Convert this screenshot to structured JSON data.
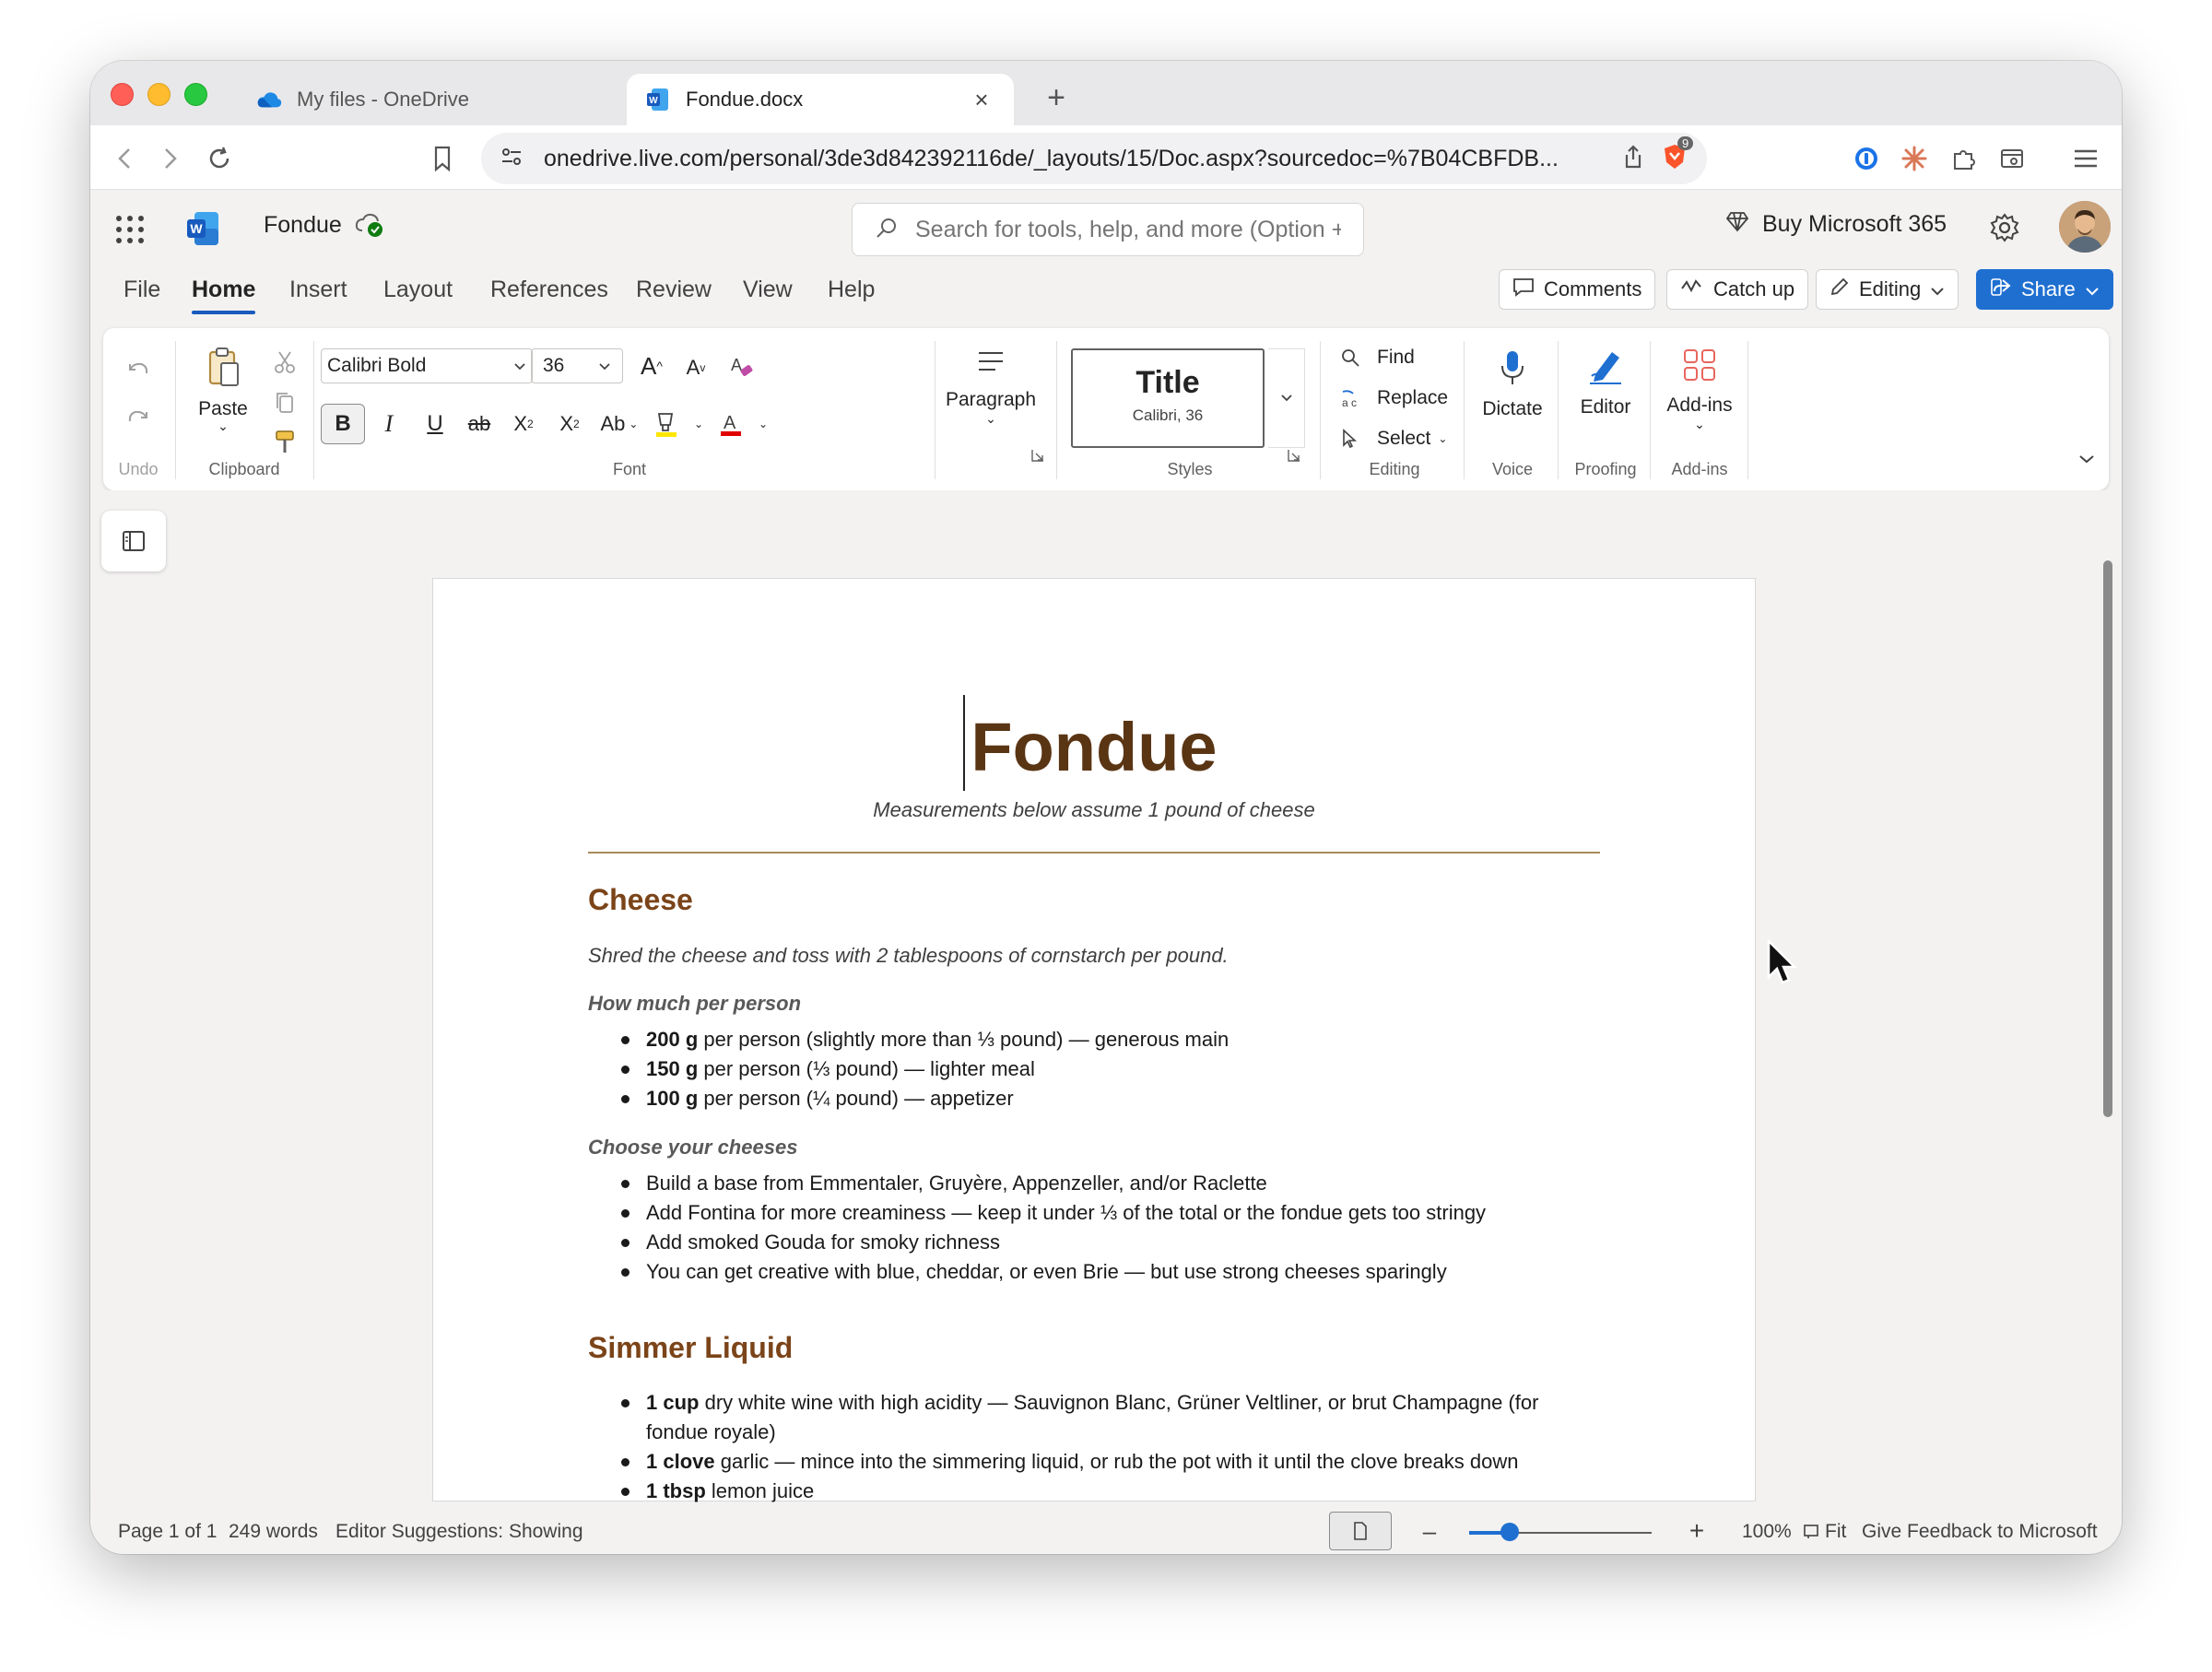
{
  "browser": {
    "tabs": [
      {
        "title": "My files - OneDrive",
        "active": false
      },
      {
        "title": "Fondue.docx",
        "active": true
      }
    ],
    "url": "onedrive.live.com/personal/3de3d842392116de/_layouts/15/Doc.aspx?sourcedoc=%7B04CBFDB...",
    "brave_badge": "9"
  },
  "app": {
    "doc_name": "Fondue",
    "search_placeholder": "Search for tools, help, and more (Option + Q)",
    "buy_label": "Buy Microsoft 365"
  },
  "ribbon_tabs": [
    "File",
    "Home",
    "Insert",
    "Layout",
    "References",
    "Review",
    "View",
    "Help"
  ],
  "header_buttons": {
    "comments": "Comments",
    "catchup": "Catch up",
    "editing": "Editing",
    "share": "Share"
  },
  "ribbon": {
    "undo_label": "Undo",
    "paste_label": "Paste",
    "clipboard_label": "Clipboard",
    "font_name": "Calibri Bold",
    "font_size": "36",
    "font_label": "Font",
    "paragraph_label": "Paragraph",
    "style_name": "Title",
    "style_desc": "Calibri, 36",
    "styles_label": "Styles",
    "find_label": "Find",
    "replace_label": "Replace",
    "select_label": "Select",
    "editing_label": "Editing",
    "dictate_label": "Dictate",
    "voice_label": "Voice",
    "editor_label": "Editor",
    "proofing_label": "Proofing",
    "addins_label": "Add-ins",
    "addins_group_label": "Add-ins"
  },
  "document": {
    "title": "Fondue",
    "subtitle": "Measurements below assume 1 pound of cheese",
    "sections": [
      {
        "heading": "Cheese",
        "intro": "Shred the cheese and toss with 2 tablespoons of cornstarch per pound.",
        "subsections": [
          {
            "heading": "How much per person",
            "items": [
              {
                "bold": "200 g",
                "text": " per person (slightly more than ⅓ pound) — generous main"
              },
              {
                "bold": "150 g",
                "text": " per person (⅓ pound) — lighter meal"
              },
              {
                "bold": "100 g",
                "text": " per person (¼ pound) — appetizer"
              }
            ]
          },
          {
            "heading": "Choose your cheeses",
            "items": [
              {
                "bold": "",
                "text": "Build a base from Emmentaler, Gruyère, Appenzeller, and/or Raclette"
              },
              {
                "bold": "",
                "text": "Add Fontina for more creaminess — keep it under ⅓ of the total or the fondue gets too stringy"
              },
              {
                "bold": "",
                "text": "Add smoked Gouda for smoky richness"
              },
              {
                "bold": "",
                "text": "You can get creative with blue, cheddar, or even Brie — but use strong cheeses sparingly"
              }
            ]
          }
        ]
      },
      {
        "heading": "Simmer Liquid",
        "items": [
          {
            "bold": "1 cup",
            "text": " dry white wine with high acidity — Sauvignon Blanc, Grüner Veltliner, or brut Champagne (for fondue royale)"
          },
          {
            "bold": "1 clove",
            "text": " garlic — mince into the simmering liquid, or rub the pot with it until the clove breaks down"
          },
          {
            "bold": "1 tbsp",
            "text": " lemon juice"
          }
        ]
      }
    ]
  },
  "status": {
    "page": "Page 1 of 1",
    "words": "249 words",
    "suggestions": "Editor Suggestions: Showing",
    "zoom": "100%",
    "zoom_level": 0.25,
    "fit": "Fit",
    "feedback": "Give Feedback to Microsoft"
  },
  "colors": {
    "accent": "#1f6fd1",
    "title": "#5a3514",
    "heading": "#7b4419"
  }
}
